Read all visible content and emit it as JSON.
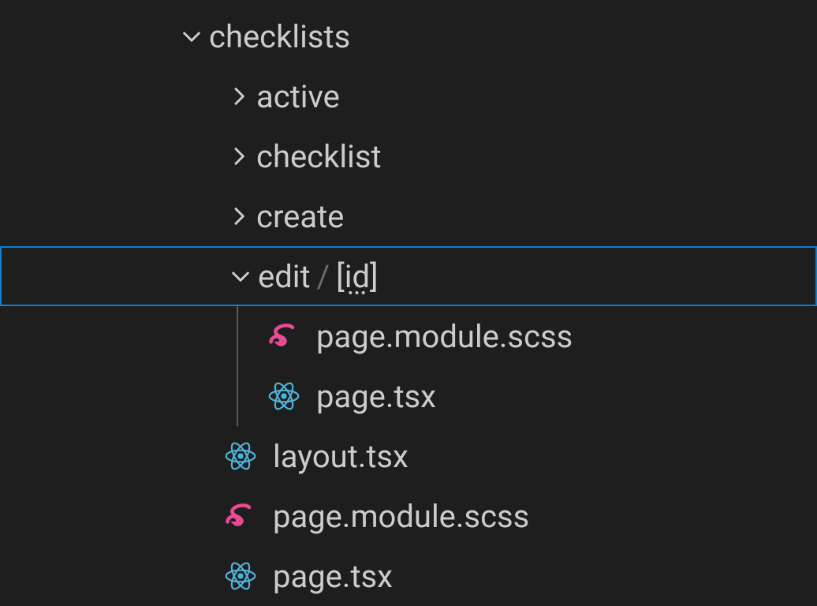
{
  "tree": {
    "root": "checklists",
    "folders": {
      "active": "active",
      "checklist": "checklist",
      "create": "create",
      "edit_path_segment1": "edit",
      "edit_path_slash": "/",
      "edit_path_segment2": "[id]"
    },
    "files": {
      "edit_page_scss": "page.module.scss",
      "edit_page_tsx": "page.tsx",
      "layout_tsx": "layout.tsx",
      "page_scss": "page.module.scss",
      "page_tsx": "page.tsx"
    }
  }
}
